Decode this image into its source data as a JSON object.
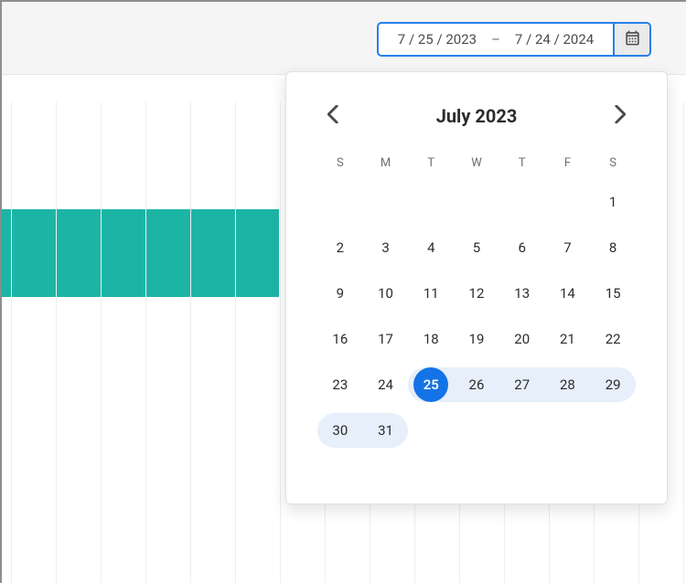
{
  "date_input": {
    "start": "7 / 25 / 2023",
    "sep": "–",
    "end": "7 / 24 / 2024"
  },
  "calendar": {
    "title": "July 2023",
    "dow": [
      "S",
      "M",
      "T",
      "W",
      "T",
      "F",
      "S"
    ],
    "weeks": [
      [
        {
          "n": ""
        },
        {
          "n": ""
        },
        {
          "n": ""
        },
        {
          "n": ""
        },
        {
          "n": ""
        },
        {
          "n": ""
        },
        {
          "n": "1"
        }
      ],
      [
        {
          "n": "2"
        },
        {
          "n": "3"
        },
        {
          "n": "4"
        },
        {
          "n": "5"
        },
        {
          "n": "6"
        },
        {
          "n": "7"
        },
        {
          "n": "8"
        }
      ],
      [
        {
          "n": "9"
        },
        {
          "n": "10"
        },
        {
          "n": "11"
        },
        {
          "n": "12"
        },
        {
          "n": "13"
        },
        {
          "n": "14"
        },
        {
          "n": "15"
        }
      ],
      [
        {
          "n": "16"
        },
        {
          "n": "17"
        },
        {
          "n": "18"
        },
        {
          "n": "19"
        },
        {
          "n": "20"
        },
        {
          "n": "21"
        },
        {
          "n": "22"
        }
      ],
      [
        {
          "n": "23"
        },
        {
          "n": "24"
        },
        {
          "n": "25",
          "sel": true,
          "rs": true
        },
        {
          "n": "26",
          "r": true
        },
        {
          "n": "27",
          "r": true
        },
        {
          "n": "28",
          "r": true
        },
        {
          "n": "29",
          "re": true
        }
      ],
      [
        {
          "n": "30",
          "rs": true
        },
        {
          "n": "31",
          "re": true
        },
        {
          "n": ""
        },
        {
          "n": ""
        },
        {
          "n": ""
        },
        {
          "n": ""
        },
        {
          "n": ""
        }
      ]
    ]
  },
  "colors": {
    "accent": "#1473e6",
    "range_bg": "#e6effa",
    "bar": "#1cb5a5"
  }
}
